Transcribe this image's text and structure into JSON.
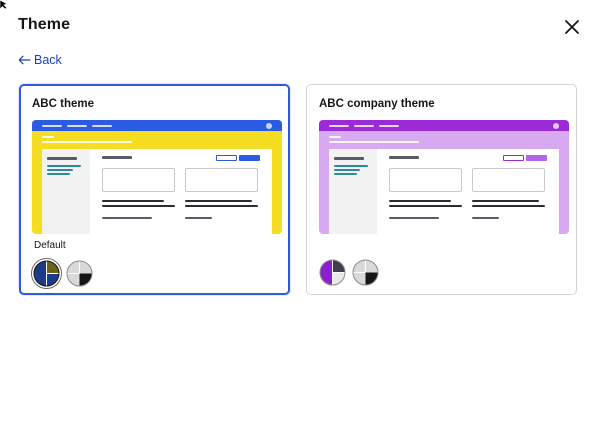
{
  "dialog": {
    "title": "Theme",
    "back_label": "Back",
    "close_icon": "close-icon",
    "back_icon": "arrow-left-icon"
  },
  "themes": [
    {
      "name": "ABC theme",
      "selected": true,
      "badge": "Default",
      "colors": {
        "primary": "#2b5be0",
        "background": "#f5dd22",
        "accent_lines": "#2c8a9f"
      },
      "swatches": [
        {
          "name": "blue-olive-swatch",
          "colors": [
            "#1e3a8a",
            "#6b6418"
          ],
          "active": true
        },
        {
          "name": "grey-black-swatch",
          "colors": [
            "#d9d9d9",
            "#161616"
          ],
          "active": false
        }
      ]
    },
    {
      "name": "ABC company theme",
      "selected": false,
      "badge": "",
      "colors": {
        "primary": "#9b2bd6",
        "background": "#d7a9f0",
        "accent_lines": "#2c8a9f"
      },
      "swatches": [
        {
          "name": "purple-dark-swatch",
          "colors": [
            "#8a1fcf",
            "#3f3f4f"
          ],
          "active": false
        },
        {
          "name": "grey-black-swatch",
          "colors": [
            "#d9d9d9",
            "#161616"
          ],
          "active": false
        }
      ]
    }
  ]
}
